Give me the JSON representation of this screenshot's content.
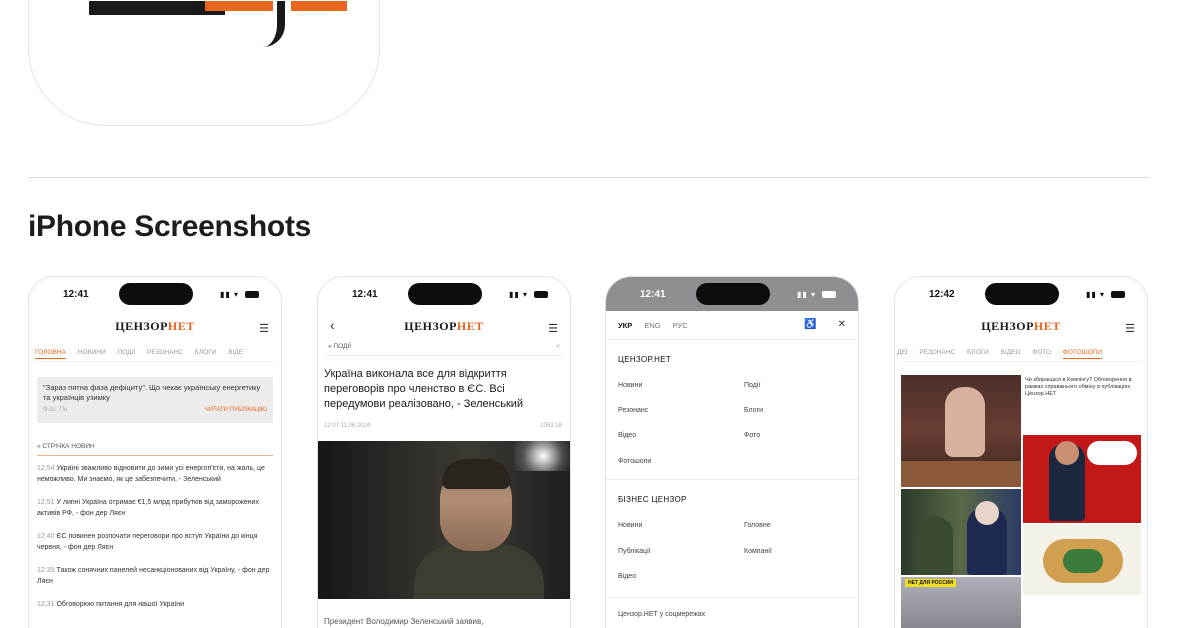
{
  "section": {
    "title": "iPhone Screenshots"
  },
  "status": {
    "time1": "12:41",
    "time2": "12:41",
    "time3": "12:41",
    "time4": "12:42"
  },
  "logo": {
    "part1": "ЦЕНЗОР",
    "part2": "НЕТ"
  },
  "phone1": {
    "tabs": [
      "ГОЛОВНА",
      "НОВИНИ",
      "ПОДІЇ",
      "РЕЗОНАНС",
      "БЛОГИ",
      "ВІДЕ"
    ],
    "quote": "\"Зараз пятна фаза дефіциту\". Що чекає українську енергетику та українців узимку",
    "quote_author": "Ф.Ш., Пн",
    "quote_link": "ЧИТАТИ ПУБЛІКАЦІЮ",
    "section_head": "» СТРІЧКА НОВИН",
    "feed": [
      {
        "time": "12:54",
        "text": "Україні зважливо відновити до зими усі енергоп'єти, на жаль, це неможливо. Ми знаємо, як це забезпечити, - Зеленський"
      },
      {
        "time": "12:51",
        "text": "У липні Україна отримає €1,5 млрд прибутків від заморожених активів РФ, - фон дер Ляєн"
      },
      {
        "time": "12:40",
        "text": "ЄС повинен розпочати переговори про вступ України до кінця червня, - фон дер Ляєн"
      },
      {
        "time": "12:35",
        "text": "Також сонячних панелей несанкціонованих від Україну, - фон дер Ляєн"
      },
      {
        "time": "12:31",
        "text": "Обговорюю питання для нашої України"
      }
    ]
  },
  "phone2": {
    "crumb": "» ПОДІЇ",
    "headline": "Україна виконала все для відкриття переговорів про членство в ЄС. Всі передумови реалізовано, - Зеленський",
    "date": "12:07 11.06.2024",
    "views": "1053  18",
    "caption": "Президент Володимир Зеленський заявив,"
  },
  "phone3": {
    "langs": [
      "УКР",
      "ENG",
      "РУС"
    ],
    "group1": {
      "title": "ЦЕНЗОР.НЕТ",
      "left": [
        "Новини",
        "Резонанс",
        "Відео",
        "Фотошопи"
      ],
      "right": [
        "Події",
        "Блоги",
        "Фото"
      ]
    },
    "group2": {
      "title": "БІЗНЕС ЦЕНЗОР",
      "left": [
        "Новини",
        "Публікації",
        "Відео"
      ],
      "right": [
        "Головне",
        "Компанії"
      ]
    },
    "footer": "Цензор.НЕТ у соцмережах"
  },
  "phone4": {
    "tabs": [
      "ДЕЇ",
      "РЕЗОНАНС",
      "БЛОГИ",
      "ВІДЕО",
      "ФОТО",
      "ФОТОШОПИ"
    ],
    "news": "Чи збираєшся в Кемпінгу? Обговорення в рамках справжнього обміну в публікаціях Цензор.НЕТ",
    "poster": "НЕТ ДЛЯ РОССИИ"
  }
}
